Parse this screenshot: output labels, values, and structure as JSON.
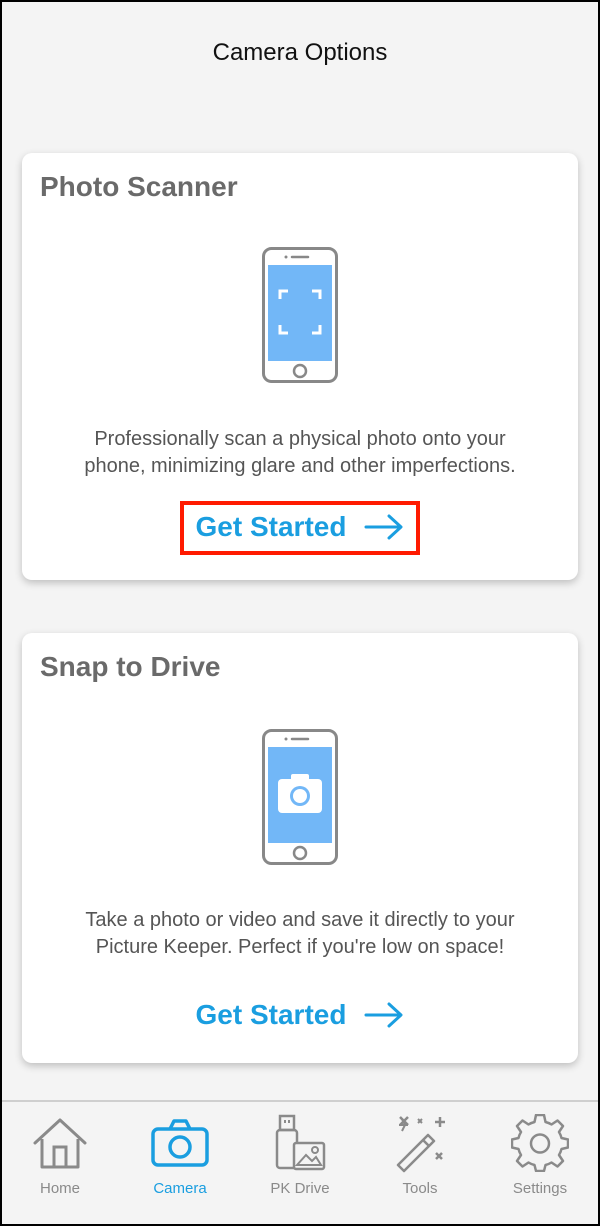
{
  "header": {
    "title": "Camera Options"
  },
  "cards": [
    {
      "title": "Photo Scanner",
      "description_line1": "Professionally scan a physical photo onto your",
      "description_line2": "phone, minimizing glare and other imperfections.",
      "cta_label": "Get Started",
      "icon": "phone-scan-icon"
    },
    {
      "title": "Snap to Drive",
      "description_line1": "Take a photo or video and save it directly to your",
      "description_line2": "Picture Keeper. Perfect if you're low on space!",
      "cta_label": "Get Started",
      "icon": "phone-camera-icon"
    }
  ],
  "tabbar": {
    "items": [
      {
        "label": "Home",
        "icon": "home-icon"
      },
      {
        "label": "Camera",
        "icon": "camera-icon",
        "active": true
      },
      {
        "label": "PK Drive",
        "icon": "pk-drive-icon"
      },
      {
        "label": "Tools",
        "icon": "magic-wand-icon"
      },
      {
        "label": "Settings",
        "icon": "gear-icon"
      }
    ]
  },
  "colors": {
    "accent": "#1a9ee0",
    "highlight_border": "#ff1a00",
    "phone_screen": "#72b7f7",
    "title_gray": "#6a6a6a"
  }
}
